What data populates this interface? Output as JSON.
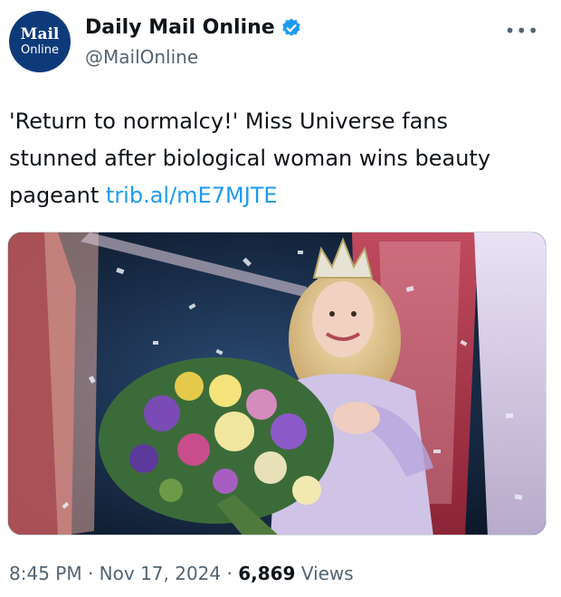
{
  "account": {
    "display_name": "Daily Mail Online",
    "handle": "@MailOnline",
    "verified_icon": "verified-badge-icon",
    "avatar": {
      "brand_top": "Mail",
      "brand_bottom": "Online",
      "background": "#0f3a7a"
    }
  },
  "more_icon": "•••",
  "tweet": {
    "text": "'Return to normalcy!' Miss Universe fans stunned after biological woman wins beauty pageant ",
    "link": "trib.al/mE7MJTE",
    "link_color": "#1d9bf0"
  },
  "media": {
    "image": "photo-of-pageant-winner-crowned-with-bouquet"
  },
  "meta": {
    "time": "8:45 PM",
    "separator": " · ",
    "date": "Nov 17, 2024",
    "views_count": "6,869",
    "views_label": " Views"
  },
  "colors": {
    "text_primary": "#0f1419",
    "text_secondary": "#536471",
    "verified": "#1d9bf0"
  }
}
